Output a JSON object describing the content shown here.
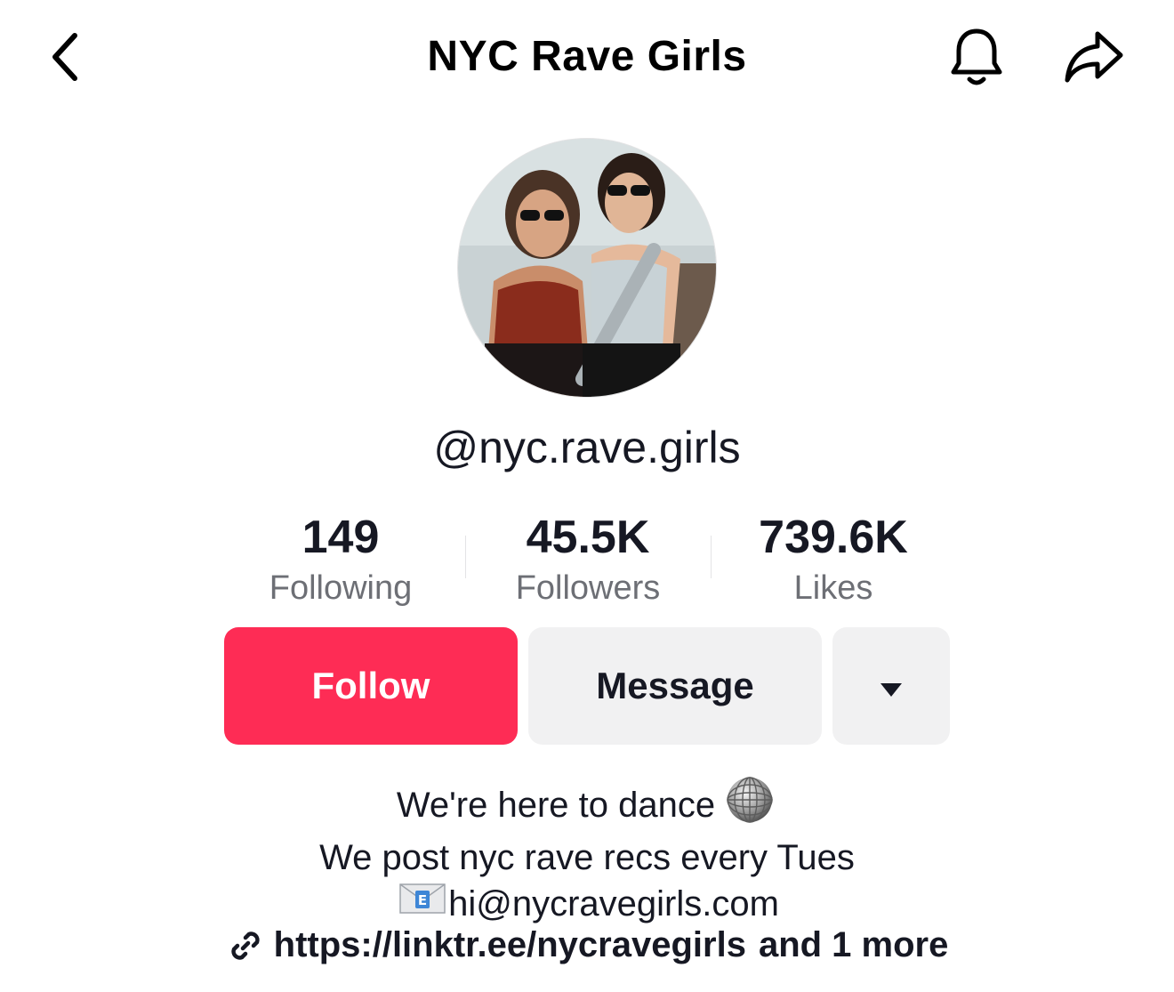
{
  "header": {
    "title": "NYC Rave Girls",
    "back_icon": "chevron-left-icon",
    "bell_icon": "bell-icon",
    "share_icon": "share-arrow-icon"
  },
  "profile": {
    "username": "@nyc.rave.girls",
    "avatar": "profile-photo"
  },
  "stats": [
    {
      "value": "149",
      "label": "Following"
    },
    {
      "value": "45.5K",
      "label": "Followers"
    },
    {
      "value": "739.6K",
      "label": "Likes"
    }
  ],
  "actions": {
    "follow_label": "Follow",
    "message_label": "Message",
    "more_icon": "caret-down-icon"
  },
  "bio": {
    "line1": "We're here to dance",
    "line2": "We post nyc rave recs every Tues",
    "line3": "hi@nycravegirls.com",
    "line1_emoji": "mirror-ball-emoji",
    "line3_emoji": "envelope-emoji"
  },
  "link": {
    "url": "https://linktr.ee/nycravegirls",
    "more": "and 1 more",
    "icon": "link-icon"
  },
  "colors": {
    "follow": "#fe2c55",
    "secondary_button": "#f1f1f2",
    "text": "#161823",
    "muted": "#6d6f75"
  }
}
